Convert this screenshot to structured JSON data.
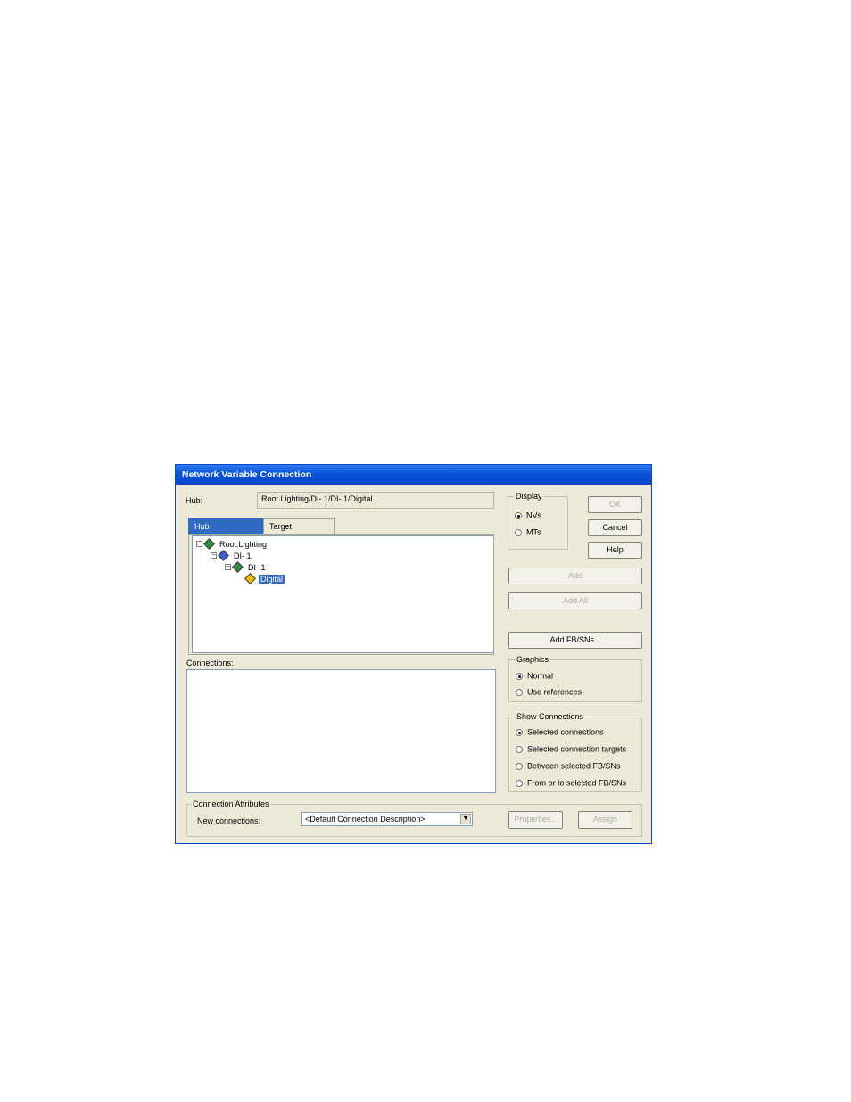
{
  "window": {
    "title": "Network Variable Connection"
  },
  "hub": {
    "label": "Hub:",
    "value": "Root.Lighting/DI- 1/DI- 1/Digital"
  },
  "tabs": [
    {
      "label": "Hub",
      "selected": true
    },
    {
      "label": "Target",
      "selected": false
    }
  ],
  "tree": {
    "nodes": [
      {
        "toggle": "−",
        "label": "Root.Lighting"
      },
      {
        "toggle": "−",
        "label": "DI- 1"
      },
      {
        "toggle": "−",
        "label": "DI- 1"
      },
      {
        "label": "Digital",
        "selected": true
      }
    ]
  },
  "connections": {
    "label": "Connections:"
  },
  "display": {
    "title": "Display",
    "options": [
      {
        "label": "NVs",
        "checked": true
      },
      {
        "label": "MTs",
        "checked": false
      }
    ]
  },
  "buttons": {
    "ok": "OK",
    "cancel": "Cancel",
    "help": "Help",
    "add": "Add",
    "add_all": "Add All",
    "add_fb": "Add FB/SNs...",
    "properties": "Properties...",
    "assign": "Assign"
  },
  "graphics": {
    "title": "Graphics",
    "options": [
      {
        "label": "Normal",
        "checked": true
      },
      {
        "label": "Use references",
        "checked": false
      }
    ]
  },
  "show_connections": {
    "title": "Show Connections",
    "options": [
      {
        "label": "Selected connections",
        "checked": true
      },
      {
        "label": "Selected connection targets",
        "checked": false
      },
      {
        "label": "Between selected FB/SNs",
        "checked": false
      },
      {
        "label": "From or to selected FB/SNs",
        "checked": false
      }
    ]
  },
  "attributes": {
    "title": "Connection Attributes",
    "new_connections_label": "New connections:",
    "new_connections_value": "<Default Connection Description>"
  },
  "colors": {
    "title_bar": "#0a54dd",
    "selection": "#316ac5",
    "dialog_bg": "#ece9d8"
  }
}
